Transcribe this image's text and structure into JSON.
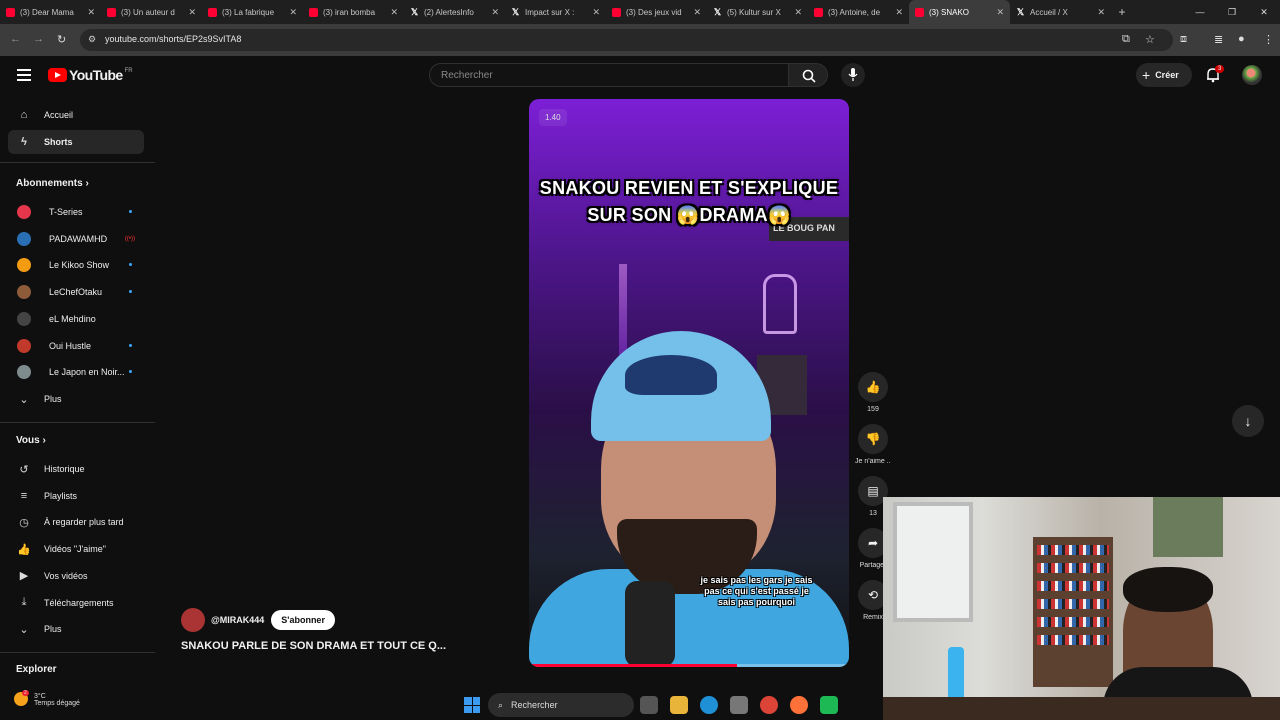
{
  "browser": {
    "tabs": [
      {
        "title": "(3) Dear Mama",
        "kind": "youtube"
      },
      {
        "title": "(3) Un auteur d",
        "kind": "youtube"
      },
      {
        "title": "(3) La fabrique",
        "kind": "youtube"
      },
      {
        "title": "(3) iran bomba",
        "kind": "youtube"
      },
      {
        "title": "(2) AlertesInfo",
        "kind": "x"
      },
      {
        "title": "Impact sur X :",
        "kind": "x"
      },
      {
        "title": "(3) Des jeux vid",
        "kind": "youtube"
      },
      {
        "title": "(5) Kultur sur X",
        "kind": "x"
      },
      {
        "title": "(3) Antoine, de",
        "kind": "youtube"
      },
      {
        "title": "(3) SNAKO",
        "kind": "youtube",
        "active": true
      },
      {
        "title": "Accueil / X",
        "kind": "x"
      }
    ],
    "url": "youtube.com/shorts/EP2s9SvITA8"
  },
  "header": {
    "logo_text": "YouTube",
    "country": "FR",
    "search_placeholder": "Rechercher",
    "create_label": "Créer",
    "notif_count": "3"
  },
  "sidebar": {
    "main": [
      {
        "label": "Accueil",
        "icon": "home-icon"
      },
      {
        "label": "Shorts",
        "icon": "shorts-icon",
        "selected": true
      }
    ],
    "subs_title": "Abonnements",
    "subs": [
      {
        "label": "T-Series",
        "color": "#e5364b",
        "dot": true
      },
      {
        "label": "PADAWAMHD",
        "color": "#2a6fb3",
        "live": true
      },
      {
        "label": "Le Kikoo Show",
        "color": "#f39c12",
        "dot": true
      },
      {
        "label": "LeChefOtaku",
        "color": "#8e5b3a",
        "dot": true
      },
      {
        "label": "eL Mehdino",
        "color": "#444444",
        "dot": false
      },
      {
        "label": "Oui Hustle",
        "color": "#c0392b",
        "dot": true
      },
      {
        "label": "Le Japon en Noir...",
        "color": "#7f8c8d",
        "dot": true
      }
    ],
    "subs_more": "Plus",
    "you_title": "Vous",
    "you": [
      {
        "label": "Historique",
        "icon": "history-icon"
      },
      {
        "label": "Playlists",
        "icon": "playlists-icon"
      },
      {
        "label": "À regarder plus tard",
        "icon": "watch-later-icon"
      },
      {
        "label": "Vidéos \"J'aime\"",
        "icon": "liked-videos-icon"
      },
      {
        "label": "Vos vidéos",
        "icon": "your-videos-icon"
      },
      {
        "label": "Téléchargements",
        "icon": "downloads-icon"
      }
    ],
    "you_more": "Plus",
    "explore_title": "Explorer"
  },
  "weather": {
    "temp": "3°C",
    "desc": "Temps dégagé",
    "badge": "2"
  },
  "short": {
    "speed": "1.40",
    "caption": "SNAKOU REVIEN ET S'EXPLIQUE SUR SON 😱DRAMA😱",
    "board_text": "LE BOUG PAN",
    "subtitle": "je sais pas les gars je sais pas ce qui s'est passé je sais pas pourquoi",
    "progress": 0.65,
    "channel": "@MIRAK444",
    "subscribe": "S'abonner",
    "title": "SNAKOU PARLE DE SON DRAMA ET TOUT CE Q..."
  },
  "actions": {
    "likes": "159",
    "dislike": "Je n'aime ...",
    "comments": "13",
    "share": "Partager",
    "remix": "Remix"
  },
  "taskbar": {
    "search": "Rechercher"
  }
}
